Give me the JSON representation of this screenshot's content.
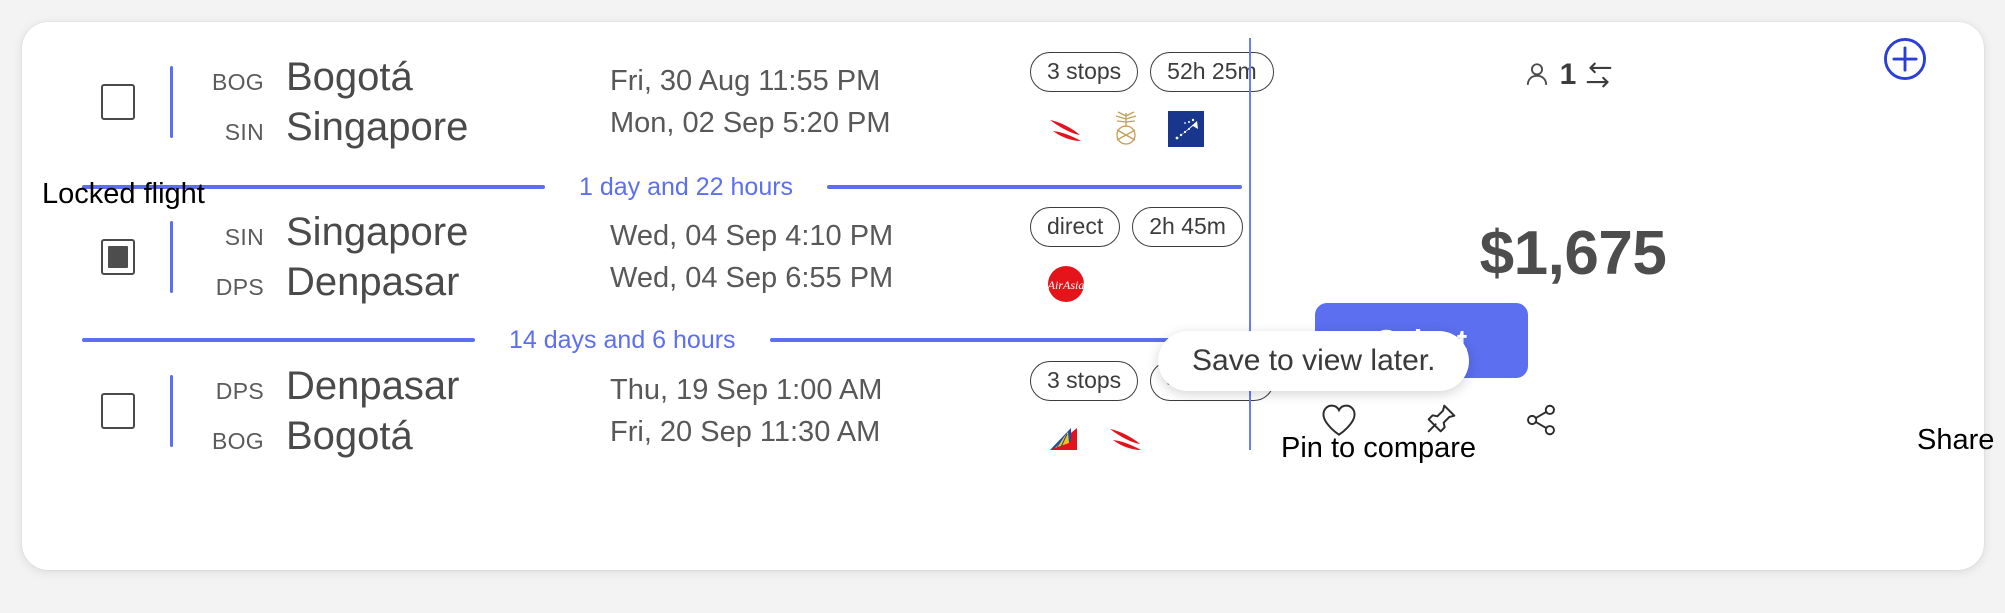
{
  "card": {
    "passengers": {
      "count": "1",
      "person_icon": "person-icon",
      "swap_icon": "swap-arrows-icon"
    },
    "add_button_icon": "plus-circle-icon",
    "price": "$1,675",
    "select_label": "Select",
    "actions": [
      {
        "icon": "heart-icon",
        "name": "save-to-favorites"
      },
      {
        "icon": "pin-icon",
        "name": "pin-to-compare"
      },
      {
        "icon": "share-icon",
        "name": "share"
      }
    ]
  },
  "tooltip": {
    "text": "Save to view later."
  },
  "annotations": {
    "locked_flight": "Locked flight",
    "pin_to_compare": "Pin to compare",
    "share": "Share"
  },
  "flights": [
    {
      "checked": false,
      "origin_code": "BOG",
      "origin_city": "Bogotá",
      "dest_code": "SIN",
      "dest_city": "Singapore",
      "depart": "Fri, 30 Aug 11:55 PM",
      "arrive": "Mon, 02 Sep 5:20 PM",
      "stops": "3 stops",
      "duration": "52h 25m",
      "airlines": [
        "iberia-logo",
        "saudia-logo",
        "garuda-logo"
      ]
    },
    {
      "checked": true,
      "origin_code": "SIN",
      "origin_city": "Singapore",
      "dest_code": "DPS",
      "dest_city": "Denpasar",
      "depart": "Wed, 04 Sep 4:10 PM",
      "arrive": "Wed, 04 Sep 6:55 PM",
      "stops": "direct",
      "duration": "2h 45m",
      "airlines": [
        "airasia-logo"
      ]
    },
    {
      "checked": false,
      "origin_code": "DPS",
      "origin_city": "Denpasar",
      "dest_code": "BOG",
      "dest_city": "Bogotá",
      "depart": "Thu, 19 Sep 1:00 AM",
      "arrive": "Fri, 20 Sep 11:30 AM",
      "stops": "3 stops",
      "duration": "47h 30m",
      "airlines": [
        "philippine-airlines-logo",
        "iberia-logo"
      ]
    }
  ],
  "layovers": [
    {
      "text": "1 day and 22 hours"
    },
    {
      "text": "14 days and 6 hours"
    }
  ],
  "colors": {
    "accent_blue": "#5b6ff0",
    "text_dark": "#4a4a4a",
    "airasia_red": "#e3151b"
  }
}
